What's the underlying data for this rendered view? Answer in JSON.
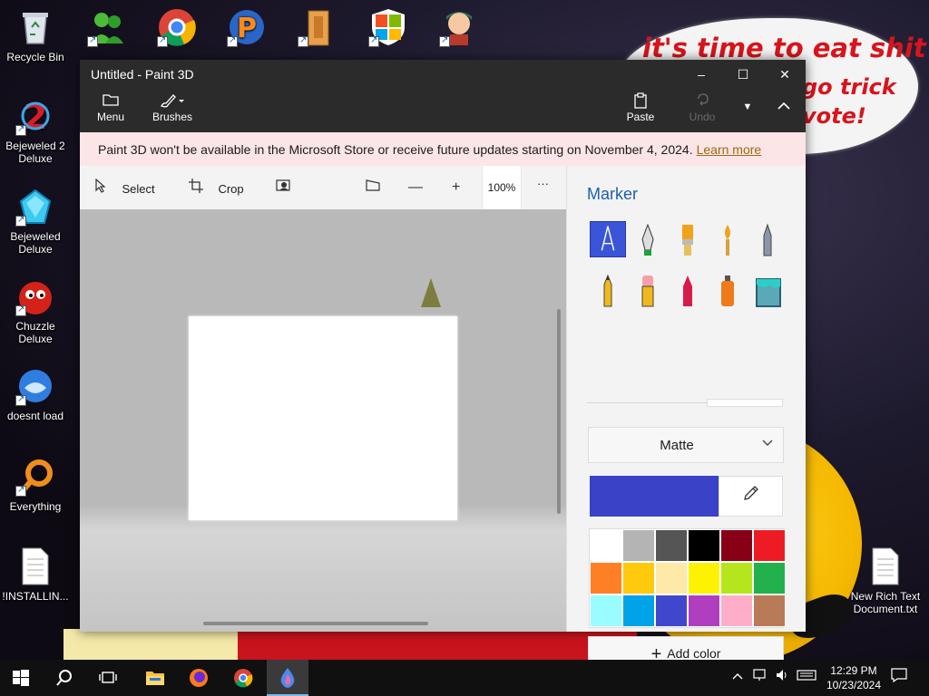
{
  "desktop": {
    "wallpaper_text": [
      "it's time to eat shit",
      "go trick",
      "vote!"
    ],
    "icons_left": [
      {
        "label": "Recycle Bin",
        "icon": "recycle-bin-icon"
      },
      {
        "label": "Bejeweled 2 Deluxe",
        "icon": "bejeweled2-icon"
      },
      {
        "label": "Bejeweled Deluxe",
        "icon": "bejeweled-icon"
      },
      {
        "label": "Chuzzle Deluxe",
        "icon": "chuzzle-icon"
      },
      {
        "label": "doesnt load",
        "icon": "thunderbird-icon"
      },
      {
        "label": "Everything",
        "icon": "everything-search-icon"
      },
      {
        "label": "!INSTALLIN...",
        "icon": "text-document-icon"
      }
    ],
    "icons_top": [
      {
        "label": "",
        "icon": "msn-messenger-icon"
      },
      {
        "label": "",
        "icon": "chrome-icon"
      },
      {
        "label": "",
        "icon": "p-app-icon"
      },
      {
        "label": "",
        "icon": "folder-archive-icon"
      },
      {
        "label": "",
        "icon": "windows-shield-icon"
      },
      {
        "label": "",
        "icon": "character-game-icon"
      }
    ],
    "icons_right": [
      {
        "label": "New Rich Text Document.txt",
        "icon": "text-document-icon"
      }
    ]
  },
  "window": {
    "title": "Untitled - Paint 3D",
    "controls": {
      "minimize": "–",
      "maximize": "☐",
      "close": "✕"
    },
    "toolbar": {
      "menu": "Menu",
      "brushes": "Brushes",
      "paste": "Paste",
      "undo": "Undo"
    },
    "notice": {
      "text": "Paint 3D won't be available in the Microsoft Store or receive future updates starting on November 4, 2024.",
      "link": "Learn more"
    },
    "canvas_toolbar": {
      "select": "Select",
      "crop": "Crop",
      "zoom": "100%",
      "more": "···"
    },
    "panel": {
      "title": "Marker",
      "brushes": [
        "marker-icon",
        "calligraphy-pen-icon",
        "oil-brush-icon",
        "watercolor-icon",
        "pixel-pen-icon",
        "pencil-icon",
        "eraser-icon",
        "crayon-icon",
        "spray-can-icon",
        "fill-bucket-icon"
      ],
      "active_brush": "Marker",
      "finish": "Matte",
      "current_color": "#3a42c8",
      "palette": [
        "#ffffff",
        "#b4b4b4",
        "#555555",
        "#000000",
        "#880015",
        "#ed1c24",
        "#ff7f27",
        "#ffc90e",
        "#ffe9a8",
        "#fff200",
        "#b5e61d",
        "#22b14c",
        "#99fcff",
        "#00a2e8",
        "#3f48cc",
        "#b03fbf",
        "#ffaec9",
        "#b97a57"
      ],
      "add_color": "Add color"
    }
  },
  "taskbar": {
    "apps": [
      "windows-start-icon",
      "search-icon",
      "task-view-icon",
      "file-explorer-icon",
      "firefox-icon",
      "chrome-icon",
      "paint3d-icon"
    ],
    "time": "12:29 PM",
    "date": "10/23/2024"
  }
}
